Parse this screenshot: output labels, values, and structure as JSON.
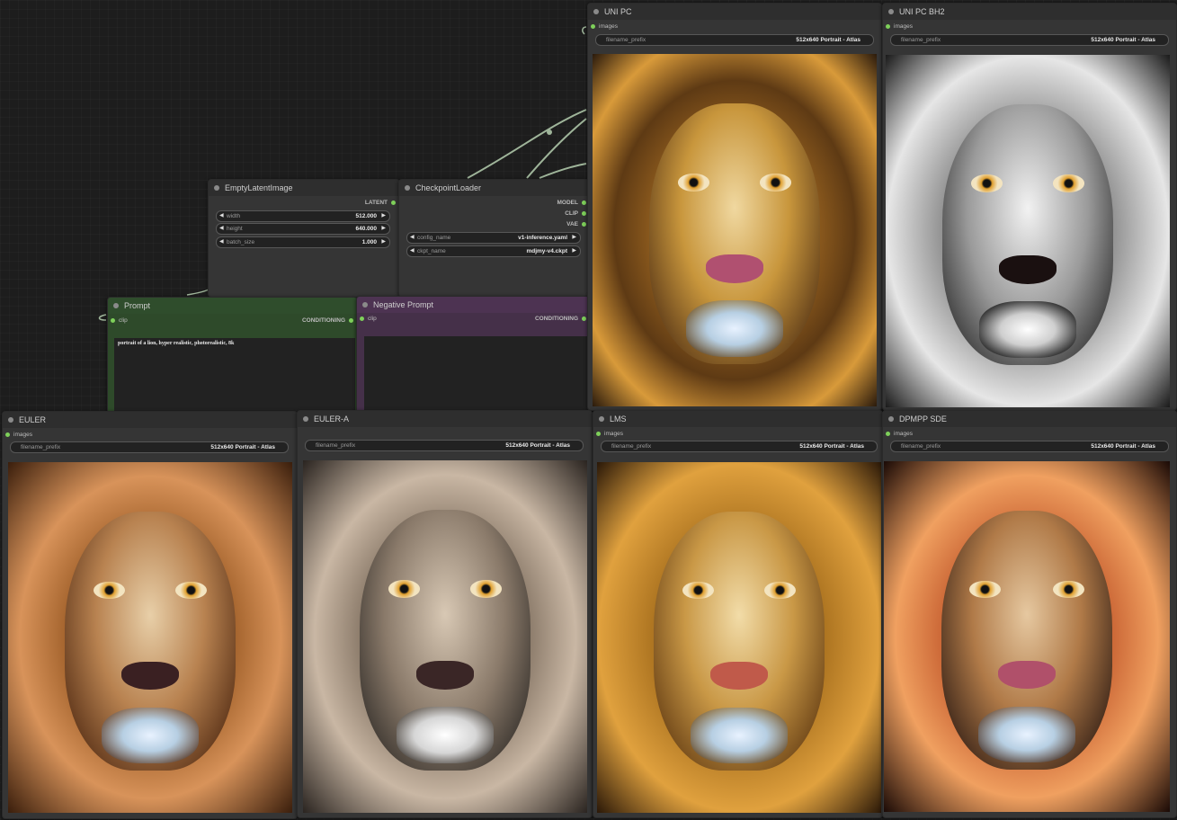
{
  "nodes": {
    "empty_latent": {
      "title": "EmptyLatentImage",
      "output": "LATENT",
      "widgets": [
        {
          "label": "width",
          "value": "512.000"
        },
        {
          "label": "height",
          "value": "640.000"
        },
        {
          "label": "batch_size",
          "value": "1.000"
        }
      ]
    },
    "checkpoint": {
      "title": "CheckpointLoader",
      "outputs": [
        "MODEL",
        "CLIP",
        "VAE"
      ],
      "widgets": [
        {
          "label": "config_name",
          "value": "v1-inference.yaml"
        },
        {
          "label": "ckpt_name",
          "value": "mdjmy-v4.ckpt"
        }
      ]
    },
    "prompt": {
      "title": "Prompt",
      "input": "clip",
      "output": "CONDITIONING",
      "text": "portrait of a lion, hyper realistic, photorealistic, 8k",
      "color": "#2f4d2c"
    },
    "negative": {
      "title": "Negative Prompt",
      "input": "clip",
      "output": "CONDITIONING",
      "text": "",
      "color": "#4d3352"
    },
    "save_nodes": [
      {
        "title": "UNI PC",
        "input": "images",
        "widget_label": "filename_prefix",
        "widget_value": "512x640 Portrait - Atlas",
        "palette": "golden"
      },
      {
        "title": "UNI PC BH2",
        "input": "images",
        "widget_label": "filename_prefix",
        "widget_value": "512x640 Portrait - Atlas",
        "palette": "silver"
      },
      {
        "title": "EULER",
        "input": "images",
        "widget_label": "filename_prefix",
        "widget_value": "512x640 Portrait - Atlas",
        "palette": "brown"
      },
      {
        "title": "EULER-A",
        "input": "images",
        "widget_label": "filename_prefix",
        "widget_value": "512x640 Portrait - Atlas",
        "palette": "grey"
      },
      {
        "title": "LMS",
        "input": "images",
        "widget_label": "filename_prefix",
        "widget_value": "512x640 Portrait - Atlas",
        "palette": "golden"
      },
      {
        "title": "DPMPP SDE",
        "input": "images",
        "widget_label": "filename_prefix",
        "widget_value": "512x640 Portrait - Atlas",
        "palette": "fire"
      }
    ]
  },
  "colors": {
    "slot_dot": "#7ed05a",
    "link": "#9fb59a",
    "node_bg": "#353535"
  }
}
